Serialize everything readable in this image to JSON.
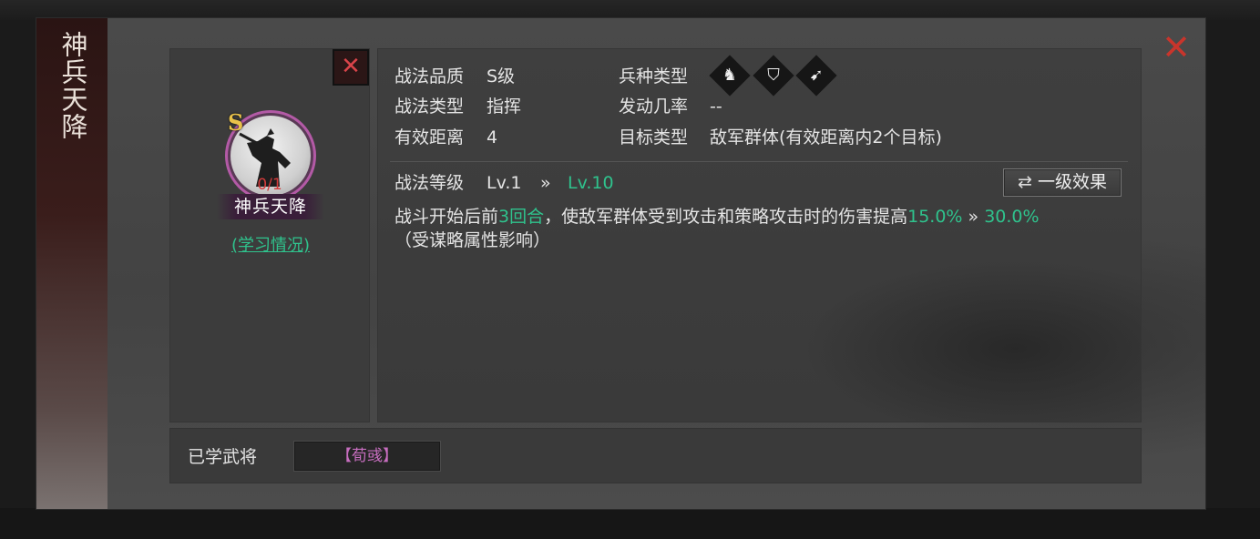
{
  "dialog": {
    "title": "神兵天降",
    "close_icon": "✕"
  },
  "skill_card": {
    "rank": "S",
    "progress": "0/1",
    "name": "神兵天降",
    "learn_link": "(学习情况)",
    "close_icon": "✕"
  },
  "attributes": {
    "quality_label": "战法品质",
    "quality_value": "S级",
    "unit_type_label": "兵种类型",
    "unit_icons": [
      "cavalry-icon",
      "shield-icon",
      "bow-icon"
    ],
    "skill_type_label": "战法类型",
    "skill_type_value": "指挥",
    "trigger_rate_label": "发动几率",
    "trigger_rate_value": "--",
    "range_label": "有效距离",
    "range_value": "4",
    "target_label": "目标类型",
    "target_value": "敌军群体(有效距离内2个目标)"
  },
  "level": {
    "label": "战法等级",
    "from": "Lv.1",
    "arrow": "»",
    "to": "Lv.10"
  },
  "switch_button": {
    "icon": "⇄",
    "label": "一级效果"
  },
  "description": {
    "part1": "战斗开始后前",
    "rounds": "3回合",
    "part2": "，使敌军群体受到攻击和策略攻击时的伤害提高",
    "from_value": "15.0%",
    "arrow": "»",
    "to_value": "30.0%",
    "note": "（受谋略属性影响）"
  },
  "learned": {
    "label": "已学武将",
    "general": "【荀彧】"
  },
  "colors": {
    "accent_green": "#2fc38d",
    "close_red": "#c8352c",
    "rank_gold": "#e9c24a",
    "general_purple": "#c86ec0"
  }
}
